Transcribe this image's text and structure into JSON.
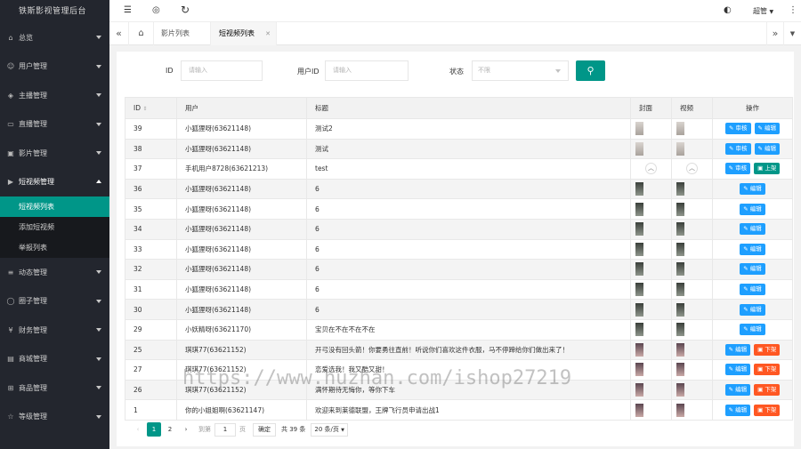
{
  "app": {
    "title": "铁斯影视管理后台"
  },
  "sidebar": {
    "items_top": [
      {
        "label": "总览",
        "icon": "home-icon"
      },
      {
        "label": "用户管理",
        "icon": "user-icon"
      },
      {
        "label": "主播管理",
        "icon": "shield-icon"
      },
      {
        "label": "直播管理",
        "icon": "live-icon"
      },
      {
        "label": "影片管理",
        "icon": "film-icon"
      },
      {
        "label": "短视频管理",
        "icon": "play-icon"
      }
    ],
    "subitems": [
      {
        "label": "短视频列表"
      },
      {
        "label": "添加短视频"
      },
      {
        "label": "举报列表"
      }
    ],
    "items_bottom": [
      {
        "label": "动态管理",
        "icon": "list-icon"
      },
      {
        "label": "圈子管理",
        "icon": "circle-icon"
      },
      {
        "label": "财务管理",
        "icon": "finance-icon"
      },
      {
        "label": "商城管理",
        "icon": "shop-icon"
      },
      {
        "label": "商品管理",
        "icon": "cart-icon"
      },
      {
        "label": "等级管理",
        "icon": "level-icon"
      }
    ]
  },
  "header": {
    "user": "超管",
    "icons": {
      "menu": "☰",
      "globe": "◎",
      "refresh": "↻",
      "skin": "◐",
      "more": "⋮"
    }
  },
  "tabs": [
    {
      "label": "影片列表"
    },
    {
      "label": "短视频列表"
    }
  ],
  "filters": {
    "id_label": "ID",
    "id_placeholder": "请输入",
    "uid_label": "用户ID",
    "uid_placeholder": "请输入",
    "status_label": "状态",
    "status_value": "不限"
  },
  "table": {
    "headers": [
      "ID",
      "用户",
      "标题",
      "封面",
      "视频",
      "操作"
    ],
    "rows": [
      {
        "id": "39",
        "user": "小狐狸呀(63621148)",
        "title": "测试2",
        "cover": "gray",
        "actions": [
          {
            "label": "审核",
            "color": "blue"
          },
          {
            "label": "编辑",
            "color": "blue"
          }
        ]
      },
      {
        "id": "38",
        "user": "小狐狸呀(63621148)",
        "title": "测试",
        "cover": "gray",
        "actions": [
          {
            "label": "审核",
            "color": "blue"
          },
          {
            "label": "编辑",
            "color": "blue"
          }
        ]
      },
      {
        "id": "37",
        "user": "手机用户8728(63621213)",
        "title": "test",
        "cover": "round",
        "actions": [
          {
            "label": "审核",
            "color": "blue"
          },
          {
            "label": "上架",
            "color": "green"
          }
        ]
      },
      {
        "id": "36",
        "user": "小狐狸呀(63621148)",
        "title": "6",
        "cover": "dark",
        "actions": [
          {
            "label": "编辑",
            "color": "blue"
          }
        ]
      },
      {
        "id": "35",
        "user": "小狐狸呀(63621148)",
        "title": "6",
        "cover": "dark",
        "actions": [
          {
            "label": "编辑",
            "color": "blue"
          }
        ]
      },
      {
        "id": "34",
        "user": "小狐狸呀(63621148)",
        "title": "6",
        "cover": "dark",
        "actions": [
          {
            "label": "编辑",
            "color": "blue"
          }
        ]
      },
      {
        "id": "33",
        "user": "小狐狸呀(63621148)",
        "title": "6",
        "cover": "dark",
        "actions": [
          {
            "label": "编辑",
            "color": "blue"
          }
        ]
      },
      {
        "id": "32",
        "user": "小狐狸呀(63621148)",
        "title": "6",
        "cover": "dark",
        "actions": [
          {
            "label": "编辑",
            "color": "blue"
          }
        ]
      },
      {
        "id": "31",
        "user": "小狐狸呀(63621148)",
        "title": "6",
        "cover": "dark",
        "actions": [
          {
            "label": "编辑",
            "color": "blue"
          }
        ]
      },
      {
        "id": "30",
        "user": "小狐狸呀(63621148)",
        "title": "6",
        "cover": "dark",
        "actions": [
          {
            "label": "编辑",
            "color": "blue"
          }
        ]
      },
      {
        "id": "29",
        "user": "小妖精呀(63621170)",
        "title": "宝贝在不在不在不在",
        "cover": "dark",
        "actions": [
          {
            "label": "编辑",
            "color": "blue"
          }
        ]
      },
      {
        "id": "25",
        "user": "琪琪77(63621152)",
        "title": "开弓没有回头箭！你要勇往直前！听说你们喜欢这件衣服，马不停蹄给你们做出来了！",
        "cover": "photo",
        "actions": [
          {
            "label": "编辑",
            "color": "blue"
          },
          {
            "label": "下架",
            "color": "red"
          }
        ]
      },
      {
        "id": "27",
        "user": "琪琪77(63621152)",
        "title": "恋爱选我！我又酷又甜！",
        "cover": "photo",
        "actions": [
          {
            "label": "编辑",
            "color": "blue"
          },
          {
            "label": "下架",
            "color": "red"
          }
        ]
      },
      {
        "id": "26",
        "user": "琪琪77(63621152)",
        "title": "满怀期待无悔你，等你下车",
        "cover": "photo",
        "actions": [
          {
            "label": "编辑",
            "color": "blue"
          },
          {
            "label": "下架",
            "color": "red"
          }
        ]
      },
      {
        "id": "1",
        "user": "你的小姐姐啊(63621147)",
        "title": "欢迎来到莱德联盟，王牌飞行员申请出战1",
        "cover": "photo",
        "actions": [
          {
            "label": "编辑",
            "color": "blue"
          },
          {
            "label": "下架",
            "color": "red"
          }
        ]
      }
    ]
  },
  "pagination": {
    "pages": [
      "1",
      "2"
    ],
    "goto_label": "到第",
    "goto_value": "1",
    "page_unit": "页",
    "confirm": "确定",
    "total": "共 39 条",
    "page_size": "20 条/页"
  },
  "watermark": "https://www.huzhan.com/ishop27219"
}
